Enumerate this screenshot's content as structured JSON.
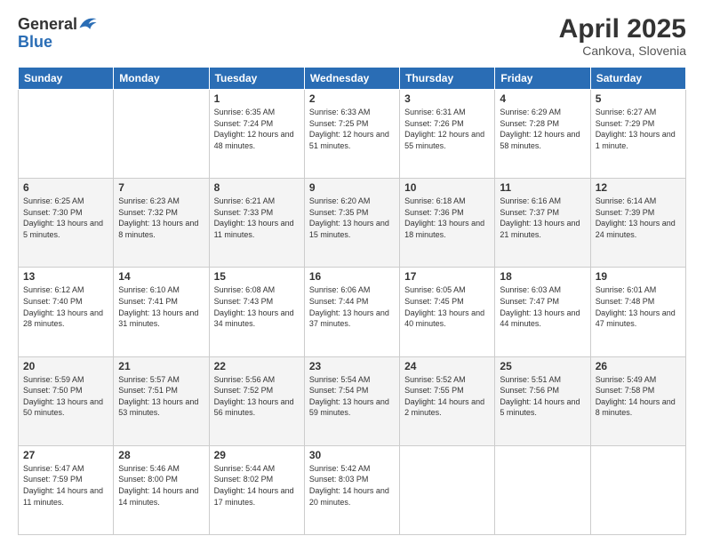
{
  "header": {
    "logo_general": "General",
    "logo_blue": "Blue",
    "month_year": "April 2025",
    "location": "Cankova, Slovenia"
  },
  "days_of_week": [
    "Sunday",
    "Monday",
    "Tuesday",
    "Wednesday",
    "Thursday",
    "Friday",
    "Saturday"
  ],
  "weeks": [
    [
      {
        "day": "",
        "info": ""
      },
      {
        "day": "",
        "info": ""
      },
      {
        "day": "1",
        "info": "Sunrise: 6:35 AM\nSunset: 7:24 PM\nDaylight: 12 hours and 48 minutes."
      },
      {
        "day": "2",
        "info": "Sunrise: 6:33 AM\nSunset: 7:25 PM\nDaylight: 12 hours and 51 minutes."
      },
      {
        "day": "3",
        "info": "Sunrise: 6:31 AM\nSunset: 7:26 PM\nDaylight: 12 hours and 55 minutes."
      },
      {
        "day": "4",
        "info": "Sunrise: 6:29 AM\nSunset: 7:28 PM\nDaylight: 12 hours and 58 minutes."
      },
      {
        "day": "5",
        "info": "Sunrise: 6:27 AM\nSunset: 7:29 PM\nDaylight: 13 hours and 1 minute."
      }
    ],
    [
      {
        "day": "6",
        "info": "Sunrise: 6:25 AM\nSunset: 7:30 PM\nDaylight: 13 hours and 5 minutes."
      },
      {
        "day": "7",
        "info": "Sunrise: 6:23 AM\nSunset: 7:32 PM\nDaylight: 13 hours and 8 minutes."
      },
      {
        "day": "8",
        "info": "Sunrise: 6:21 AM\nSunset: 7:33 PM\nDaylight: 13 hours and 11 minutes."
      },
      {
        "day": "9",
        "info": "Sunrise: 6:20 AM\nSunset: 7:35 PM\nDaylight: 13 hours and 15 minutes."
      },
      {
        "day": "10",
        "info": "Sunrise: 6:18 AM\nSunset: 7:36 PM\nDaylight: 13 hours and 18 minutes."
      },
      {
        "day": "11",
        "info": "Sunrise: 6:16 AM\nSunset: 7:37 PM\nDaylight: 13 hours and 21 minutes."
      },
      {
        "day": "12",
        "info": "Sunrise: 6:14 AM\nSunset: 7:39 PM\nDaylight: 13 hours and 24 minutes."
      }
    ],
    [
      {
        "day": "13",
        "info": "Sunrise: 6:12 AM\nSunset: 7:40 PM\nDaylight: 13 hours and 28 minutes."
      },
      {
        "day": "14",
        "info": "Sunrise: 6:10 AM\nSunset: 7:41 PM\nDaylight: 13 hours and 31 minutes."
      },
      {
        "day": "15",
        "info": "Sunrise: 6:08 AM\nSunset: 7:43 PM\nDaylight: 13 hours and 34 minutes."
      },
      {
        "day": "16",
        "info": "Sunrise: 6:06 AM\nSunset: 7:44 PM\nDaylight: 13 hours and 37 minutes."
      },
      {
        "day": "17",
        "info": "Sunrise: 6:05 AM\nSunset: 7:45 PM\nDaylight: 13 hours and 40 minutes."
      },
      {
        "day": "18",
        "info": "Sunrise: 6:03 AM\nSunset: 7:47 PM\nDaylight: 13 hours and 44 minutes."
      },
      {
        "day": "19",
        "info": "Sunrise: 6:01 AM\nSunset: 7:48 PM\nDaylight: 13 hours and 47 minutes."
      }
    ],
    [
      {
        "day": "20",
        "info": "Sunrise: 5:59 AM\nSunset: 7:50 PM\nDaylight: 13 hours and 50 minutes."
      },
      {
        "day": "21",
        "info": "Sunrise: 5:57 AM\nSunset: 7:51 PM\nDaylight: 13 hours and 53 minutes."
      },
      {
        "day": "22",
        "info": "Sunrise: 5:56 AM\nSunset: 7:52 PM\nDaylight: 13 hours and 56 minutes."
      },
      {
        "day": "23",
        "info": "Sunrise: 5:54 AM\nSunset: 7:54 PM\nDaylight: 13 hours and 59 minutes."
      },
      {
        "day": "24",
        "info": "Sunrise: 5:52 AM\nSunset: 7:55 PM\nDaylight: 14 hours and 2 minutes."
      },
      {
        "day": "25",
        "info": "Sunrise: 5:51 AM\nSunset: 7:56 PM\nDaylight: 14 hours and 5 minutes."
      },
      {
        "day": "26",
        "info": "Sunrise: 5:49 AM\nSunset: 7:58 PM\nDaylight: 14 hours and 8 minutes."
      }
    ],
    [
      {
        "day": "27",
        "info": "Sunrise: 5:47 AM\nSunset: 7:59 PM\nDaylight: 14 hours and 11 minutes."
      },
      {
        "day": "28",
        "info": "Sunrise: 5:46 AM\nSunset: 8:00 PM\nDaylight: 14 hours and 14 minutes."
      },
      {
        "day": "29",
        "info": "Sunrise: 5:44 AM\nSunset: 8:02 PM\nDaylight: 14 hours and 17 minutes."
      },
      {
        "day": "30",
        "info": "Sunrise: 5:42 AM\nSunset: 8:03 PM\nDaylight: 14 hours and 20 minutes."
      },
      {
        "day": "",
        "info": ""
      },
      {
        "day": "",
        "info": ""
      },
      {
        "day": "",
        "info": ""
      }
    ]
  ]
}
